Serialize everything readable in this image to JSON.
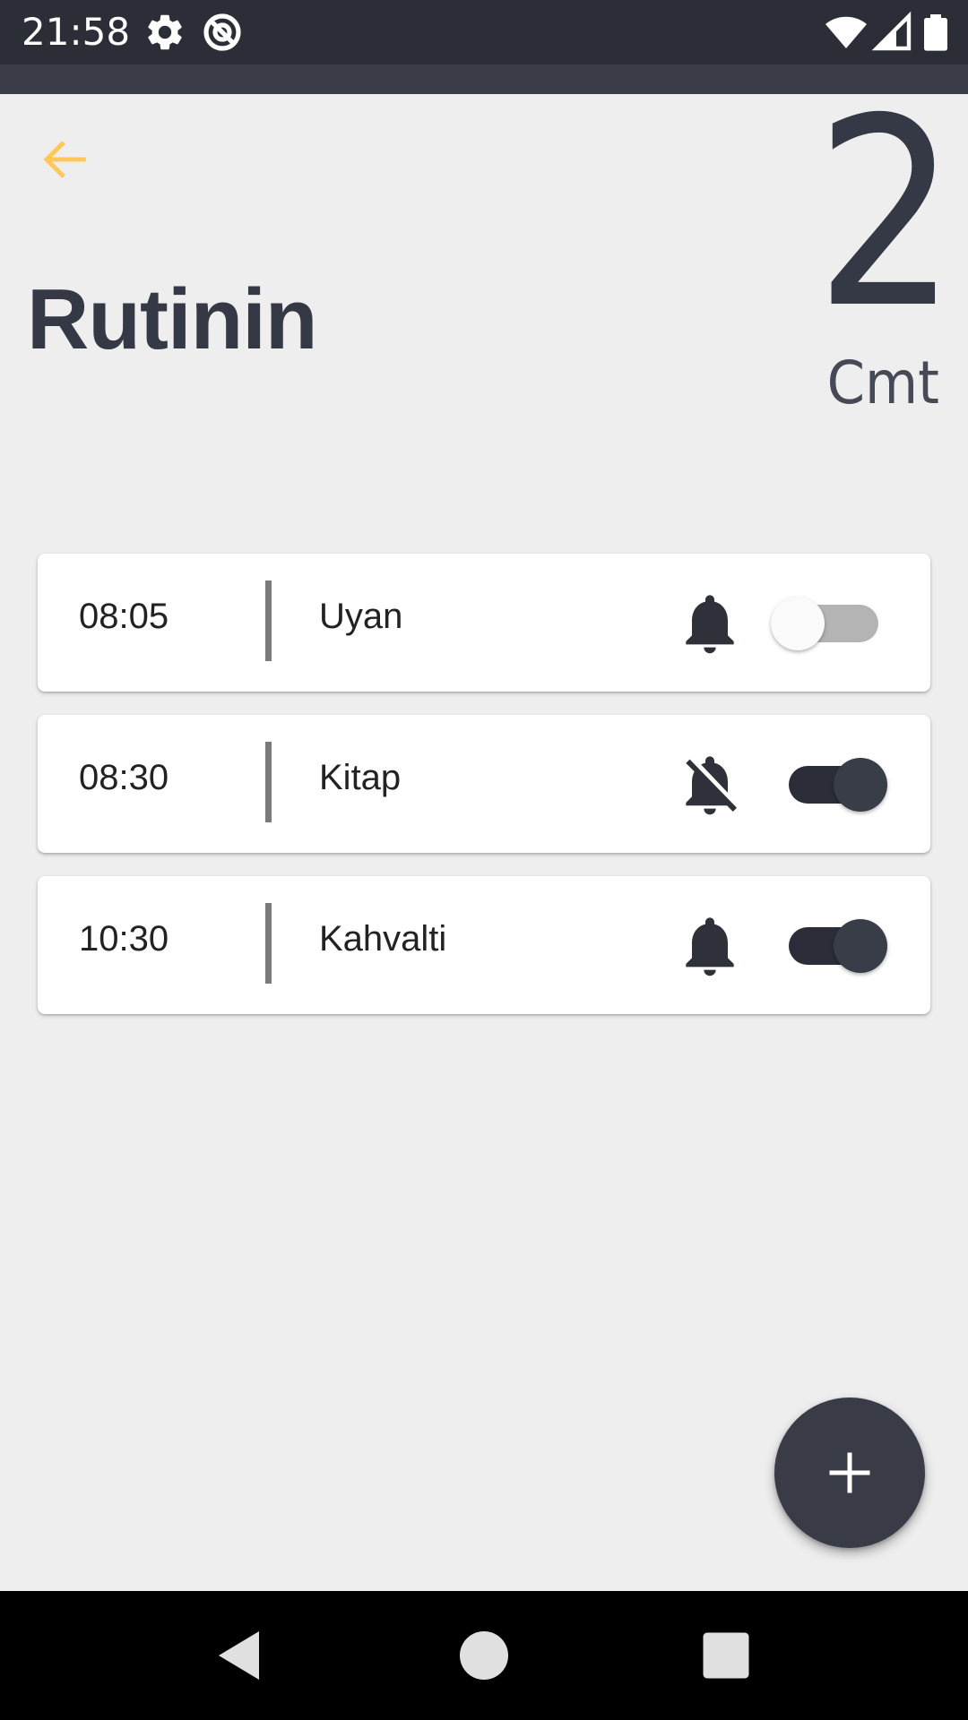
{
  "status_bar": {
    "time": "21:58",
    "icons": [
      "gear-icon",
      "sync-icon",
      "wifi-icon",
      "signal-icon",
      "battery-icon"
    ]
  },
  "header": {
    "back_icon": "arrow-left-icon",
    "title": "Rutinin",
    "count": "2",
    "count_unit": "Cmt"
  },
  "routines": [
    {
      "time": "08:05",
      "name": "Uyan",
      "bell": "bell-icon",
      "bell_muted": false,
      "enabled": false
    },
    {
      "time": "08:30",
      "name": "Kitap",
      "bell": "bell-off-icon",
      "bell_muted": true,
      "enabled": true
    },
    {
      "time": "10:30",
      "name": "Kahvalti",
      "bell": "bell-icon",
      "bell_muted": false,
      "enabled": true
    }
  ],
  "fab": {
    "icon": "plus-icon"
  },
  "nav_bar": {
    "icons": [
      "back-triangle-icon",
      "home-circle-icon",
      "recents-square-icon"
    ]
  },
  "colors": {
    "accent": "#FFC857",
    "dark": "#353945",
    "background": "#EEEEEE",
    "status_bar": "#2B2E36"
  }
}
